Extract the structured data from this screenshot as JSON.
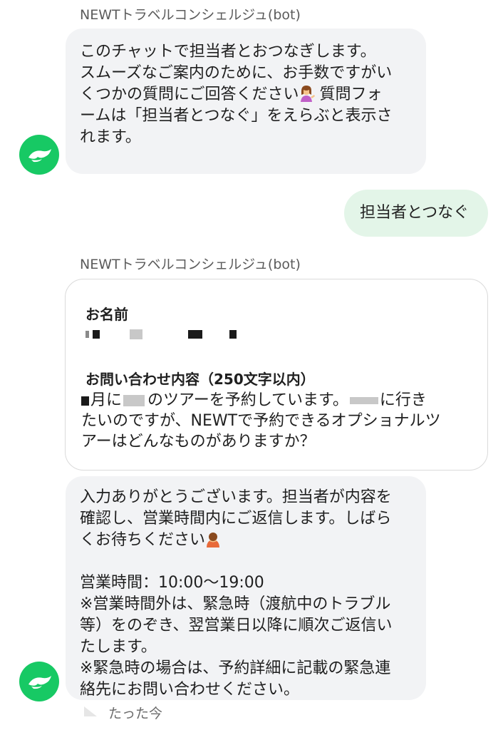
{
  "chat": {
    "bot_name": "NEWTトラベルコンシェルジュ(bot)",
    "msg1": {
      "p1": "このチャットで担当者とおつなぎします。",
      "p2a": "スムーズなご案内のために、お手数ですがい\nくつかの質問にご回答ください",
      "p2b": " 質問フォ\nームは「担当者とつなぐ」をえらぶと表示さ\nれます。",
      "emoji_icon": "person-tipping-hand-icon"
    },
    "user_msg": "担当者とつなぐ",
    "form": {
      "name_label": "お名前",
      "inquiry_label": "お問い合わせ内容（250文字以内）",
      "inquiry_a": "月に",
      "inquiry_b": "のツアーを予約しています。",
      "inquiry_c": "に行き\nたいのですが、NEWTで予約できるオプショナルツ\nアーはどんなものがありますか？"
    },
    "msg2": {
      "p1": "入力ありがとうございます。担当者が内容を\n確認し、営業時間内にご返信します。しばら\nくお待ちください",
      "emoji_icon": "person-bowing-icon",
      "p2": "\n\n営業時間：10:00〜19:00",
      "p3": "\n※営業時間外は、緊急時（渡航中のトラブル\n等）をのぞき、翌営業日以降に順次ご返信い\nたします。\n※緊急時の場合は、予約詳細に記載の緊急連\n絡先にお問い合わせください。"
    },
    "timestamp": "たった今"
  },
  "colors": {
    "bot_bubble": "#f2f3f5",
    "user_bubble": "#e3f5e8",
    "avatar": "#17c964"
  }
}
